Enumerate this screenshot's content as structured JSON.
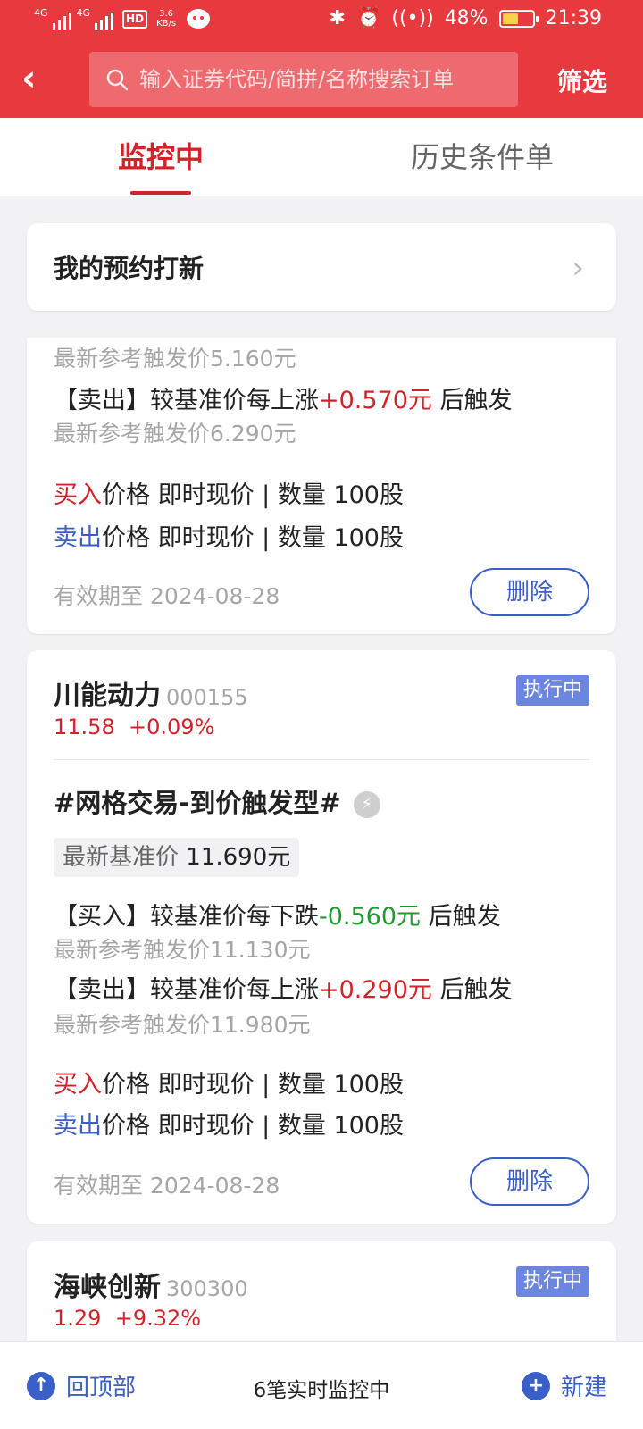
{
  "status_bar": {
    "sig1": "4G",
    "sig2": "4G",
    "hd": "HD",
    "net_speed": "3.6",
    "net_unit": "KB/s",
    "battery": "48%",
    "time": "21:39"
  },
  "header": {
    "search_placeholder": "输入证券代码/简拼/名称搜索订单",
    "filter_label": "筛选"
  },
  "tabs": [
    {
      "label": "监控中",
      "active": true
    },
    {
      "label": "历史条件单",
      "active": false
    }
  ],
  "ipo_entry": {
    "label": "我的预约打新"
  },
  "card1": {
    "ref_trigger_1": "最新参考触发价5.160元",
    "sell_prefix": "【卖出】较基准价每上涨",
    "sell_delta": "+0.570元",
    "sell_suffix": " 后触发",
    "ref_trigger_2": "最新参考触发价6.290元",
    "buy_label": "买入",
    "buy_detail": "价格 即时现价 | 数量 100股",
    "sell_label": "卖出",
    "sell_detail": "价格 即时现价 | 数量 100股",
    "expiry": "有效期至 2024-08-28",
    "delete_label": "删除"
  },
  "card2": {
    "name": "川能动力",
    "code": "000155",
    "status": "执行中",
    "price": "11.58",
    "change": "+0.09%",
    "strategy": "#网格交易-到价触发型#",
    "base_label": "最新基准价",
    "base_value": "11.690元",
    "buy_prefix": "【买入】较基准价每下跌",
    "buy_delta": "-0.560元",
    "buy_suffix": " 后触发",
    "ref_trigger_1": "最新参考触发价11.130元",
    "sell_prefix": "【卖出】较基准价每上涨",
    "sell_delta": "+0.290元",
    "sell_suffix": " 后触发",
    "ref_trigger_2": "最新参考触发价11.980元",
    "buy_label": "买入",
    "buy_detail": "价格 即时现价 | 数量 100股",
    "sell_label": "卖出",
    "sell_detail": "价格 即时现价 | 数量 100股",
    "expiry": "有效期至 2024-08-28",
    "delete_label": "删除"
  },
  "card3": {
    "name": "海峡创新",
    "code": "300300",
    "status": "执行中",
    "price": "1.29",
    "change": "+9.32%"
  },
  "bottom_bar": {
    "back_top_label": "回顶部",
    "monitor_count": "6笔实时监控中",
    "new_label": "新建"
  },
  "icons": [
    "back-arrow-icon",
    "search-icon",
    "chevron-right-icon",
    "flash-icon",
    "arrow-up-circle-icon",
    "plus-circle-icon",
    "bluetooth-icon",
    "alarm-icon",
    "battery-icon",
    "wechat-icon"
  ],
  "colors": {
    "brand_red": "#e8393f",
    "price_red": "#d2232a",
    "price_green": "#1f9a2f",
    "action_blue": "#3a5fc8",
    "badge_blue": "#6b86e0"
  }
}
